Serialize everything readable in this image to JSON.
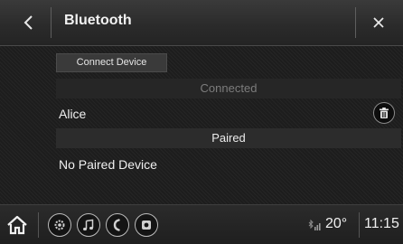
{
  "header": {
    "title": "Bluetooth",
    "back_icon": "chevron-left-icon",
    "close_icon": "close-icon"
  },
  "content": {
    "connect_button_label": "Connect Device",
    "connected_section_label": "Connected",
    "connected_devices": [
      {
        "name": "Alice",
        "action_icon": "trash-icon"
      }
    ],
    "paired_section_label": "Paired",
    "paired_empty_text": "No Paired Device"
  },
  "status_bar": {
    "home_icon": "home-icon",
    "buttons": [
      "settings-icon",
      "music-note-icon",
      "phone-icon",
      "camera-icon"
    ],
    "signal_icon": "bluetooth-signal-icon",
    "temperature": "20°",
    "time": "11:15"
  },
  "colors": {
    "background": "#1d1d1d",
    "header": "#2e2e2e",
    "text": "#ececec",
    "muted_text": "#7c7c7c"
  }
}
